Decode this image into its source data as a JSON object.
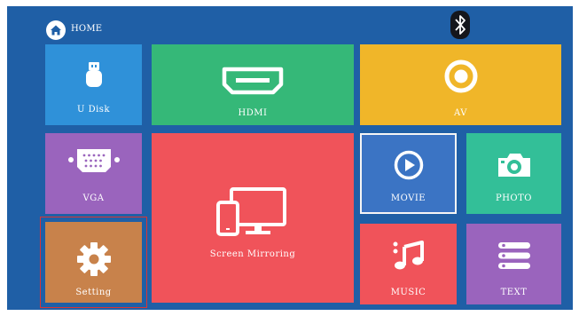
{
  "topbar": {
    "home_label": "HOME",
    "home_icon": "home-icon",
    "status_icon": "bluetooth-icon"
  },
  "tiles": {
    "udisk": {
      "label": "U Disk",
      "icon": "usb-icon",
      "color": "#2f91d9"
    },
    "hdmi": {
      "label": "HDMI",
      "icon": "hdmi-icon",
      "color": "#35b878"
    },
    "av": {
      "label": "AV",
      "icon": "av-icon",
      "color": "#f0b629"
    },
    "vga": {
      "label": "VGA",
      "icon": "vga-icon",
      "color": "#9a64bd"
    },
    "mirror": {
      "label": "Screen Mirroring",
      "icon": "screen-mirroring-icon",
      "color": "#f0535a"
    },
    "movie": {
      "label": "MOVIE",
      "icon": "play-icon",
      "color": "#3b74c4"
    },
    "photo": {
      "label": "PHOTO",
      "icon": "camera-icon",
      "color": "#33bf98"
    },
    "setting": {
      "label": "Setting",
      "icon": "gear-icon",
      "color": "#c8824b"
    },
    "music": {
      "label": "MUSIC",
      "icon": "music-icon",
      "color": "#f0535a"
    },
    "text": {
      "label": "TEXT",
      "icon": "list-icon",
      "color": "#9a64bd"
    }
  }
}
